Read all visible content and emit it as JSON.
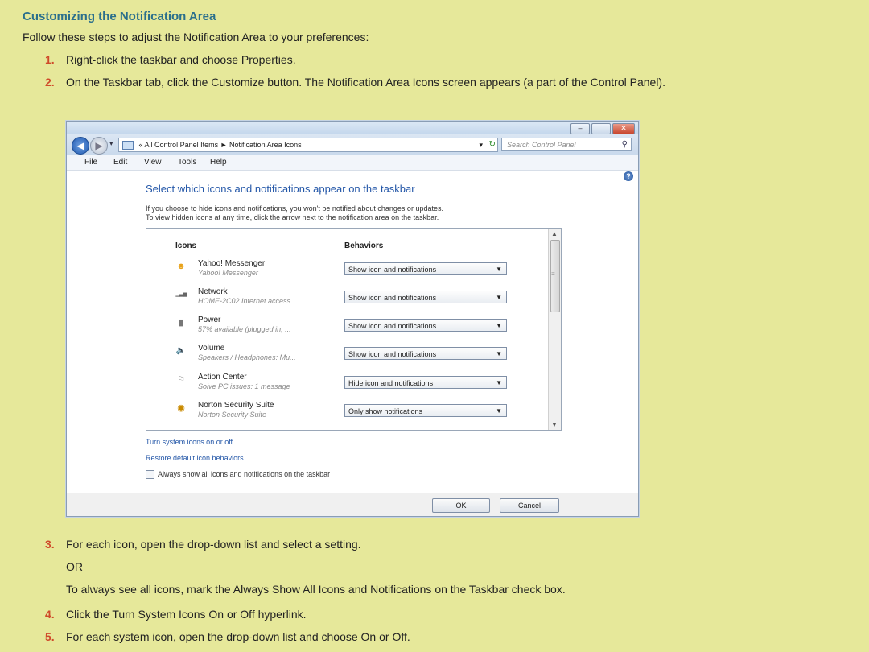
{
  "doc": {
    "title": "Customizing the Notification Area",
    "intro": "Follow these steps to adjust the Notification Area to your preferences:",
    "steps": [
      {
        "num": "1.",
        "text": "Right-click the taskbar and choose Properties."
      },
      {
        "num": "2.",
        "text": "On the Taskbar tab, click the Customize button. The Notification Area Icons screen appears (a part of the Control Panel)."
      },
      {
        "num": "3.",
        "text": "For each icon, open the drop-down list and select a setting."
      },
      {
        "num": "4.",
        "text": "Click the Turn System Icons On or Off hyperlink."
      },
      {
        "num": "5.",
        "text": "For each system icon, open the drop-down list and choose On or Off."
      }
    ],
    "or_text": "OR",
    "alt_text": "To always see all icons, mark the Always Show All Icons and Notifications on the Taskbar check box."
  },
  "window": {
    "title_controls": {
      "minimize": "–",
      "maximize": "□",
      "close": "✕"
    },
    "address": {
      "prefix": "«",
      "crumb1": "All Control Panel Items",
      "sep": "►",
      "crumb2": "Notification Area Icons",
      "dropdown": "▾",
      "refresh": "↻"
    },
    "search_placeholder": "Search Control Panel",
    "search_icon": "⚲",
    "menu": [
      "File",
      "Edit",
      "View",
      "Tools",
      "Help"
    ],
    "help_icon": "?",
    "heading": "Select which icons and notifications appear on the taskbar",
    "desc1": "If you choose to hide icons and notifications, you won't be notified about changes or updates.",
    "desc2": "To view hidden icons at any time, click the arrow next to the notification area on the taskbar.",
    "col_icons": "Icons",
    "col_behaviors": "Behaviors",
    "rows": [
      {
        "icon": "yahoo-messenger-icon",
        "glyph": "☻",
        "color": "#e8a21a",
        "name": "Yahoo! Messenger",
        "sub": "Yahoo! Messenger",
        "behavior": "Show icon and notifications"
      },
      {
        "icon": "network-icon",
        "glyph": "▁▃▅",
        "color": "#666666",
        "name": "Network",
        "sub": "HOME-2C02 Internet access ...",
        "behavior": "Show icon and notifications"
      },
      {
        "icon": "power-icon",
        "glyph": "▮",
        "color": "#777777",
        "name": "Power",
        "sub": "57% available (plugged in, ...",
        "behavior": "Show icon and notifications"
      },
      {
        "icon": "volume-icon",
        "glyph": "🔈",
        "color": "#c0392b",
        "name": "Volume",
        "sub": "Speakers / Headphones: Mu...",
        "behavior": "Show icon and notifications"
      },
      {
        "icon": "action-center-icon",
        "glyph": "⚐",
        "color": "#888888",
        "name": "Action Center",
        "sub": "Solve PC issues: 1 message",
        "behavior": "Hide icon and notifications"
      },
      {
        "icon": "norton-icon",
        "glyph": "◉",
        "color": "#c98a00",
        "name": "Norton Security Suite",
        "sub": "Norton Security Suite",
        "behavior": "Only show notifications"
      }
    ],
    "link1": "Turn system icons on or off",
    "link2": "Restore default icon behaviors",
    "checkbox_label": "Always show all icons and notifications on the taskbar",
    "ok": "OK",
    "cancel": "Cancel",
    "back_glyph": "◀",
    "forward_glyph": "▶",
    "scroll_up": "▲",
    "scroll_down": "▼",
    "scroll_grip": "≡"
  },
  "colors": {
    "background": "#e6e89a",
    "title": "#2b6f8c",
    "step_number": "#cf4a2a",
    "link": "#2457a8"
  }
}
